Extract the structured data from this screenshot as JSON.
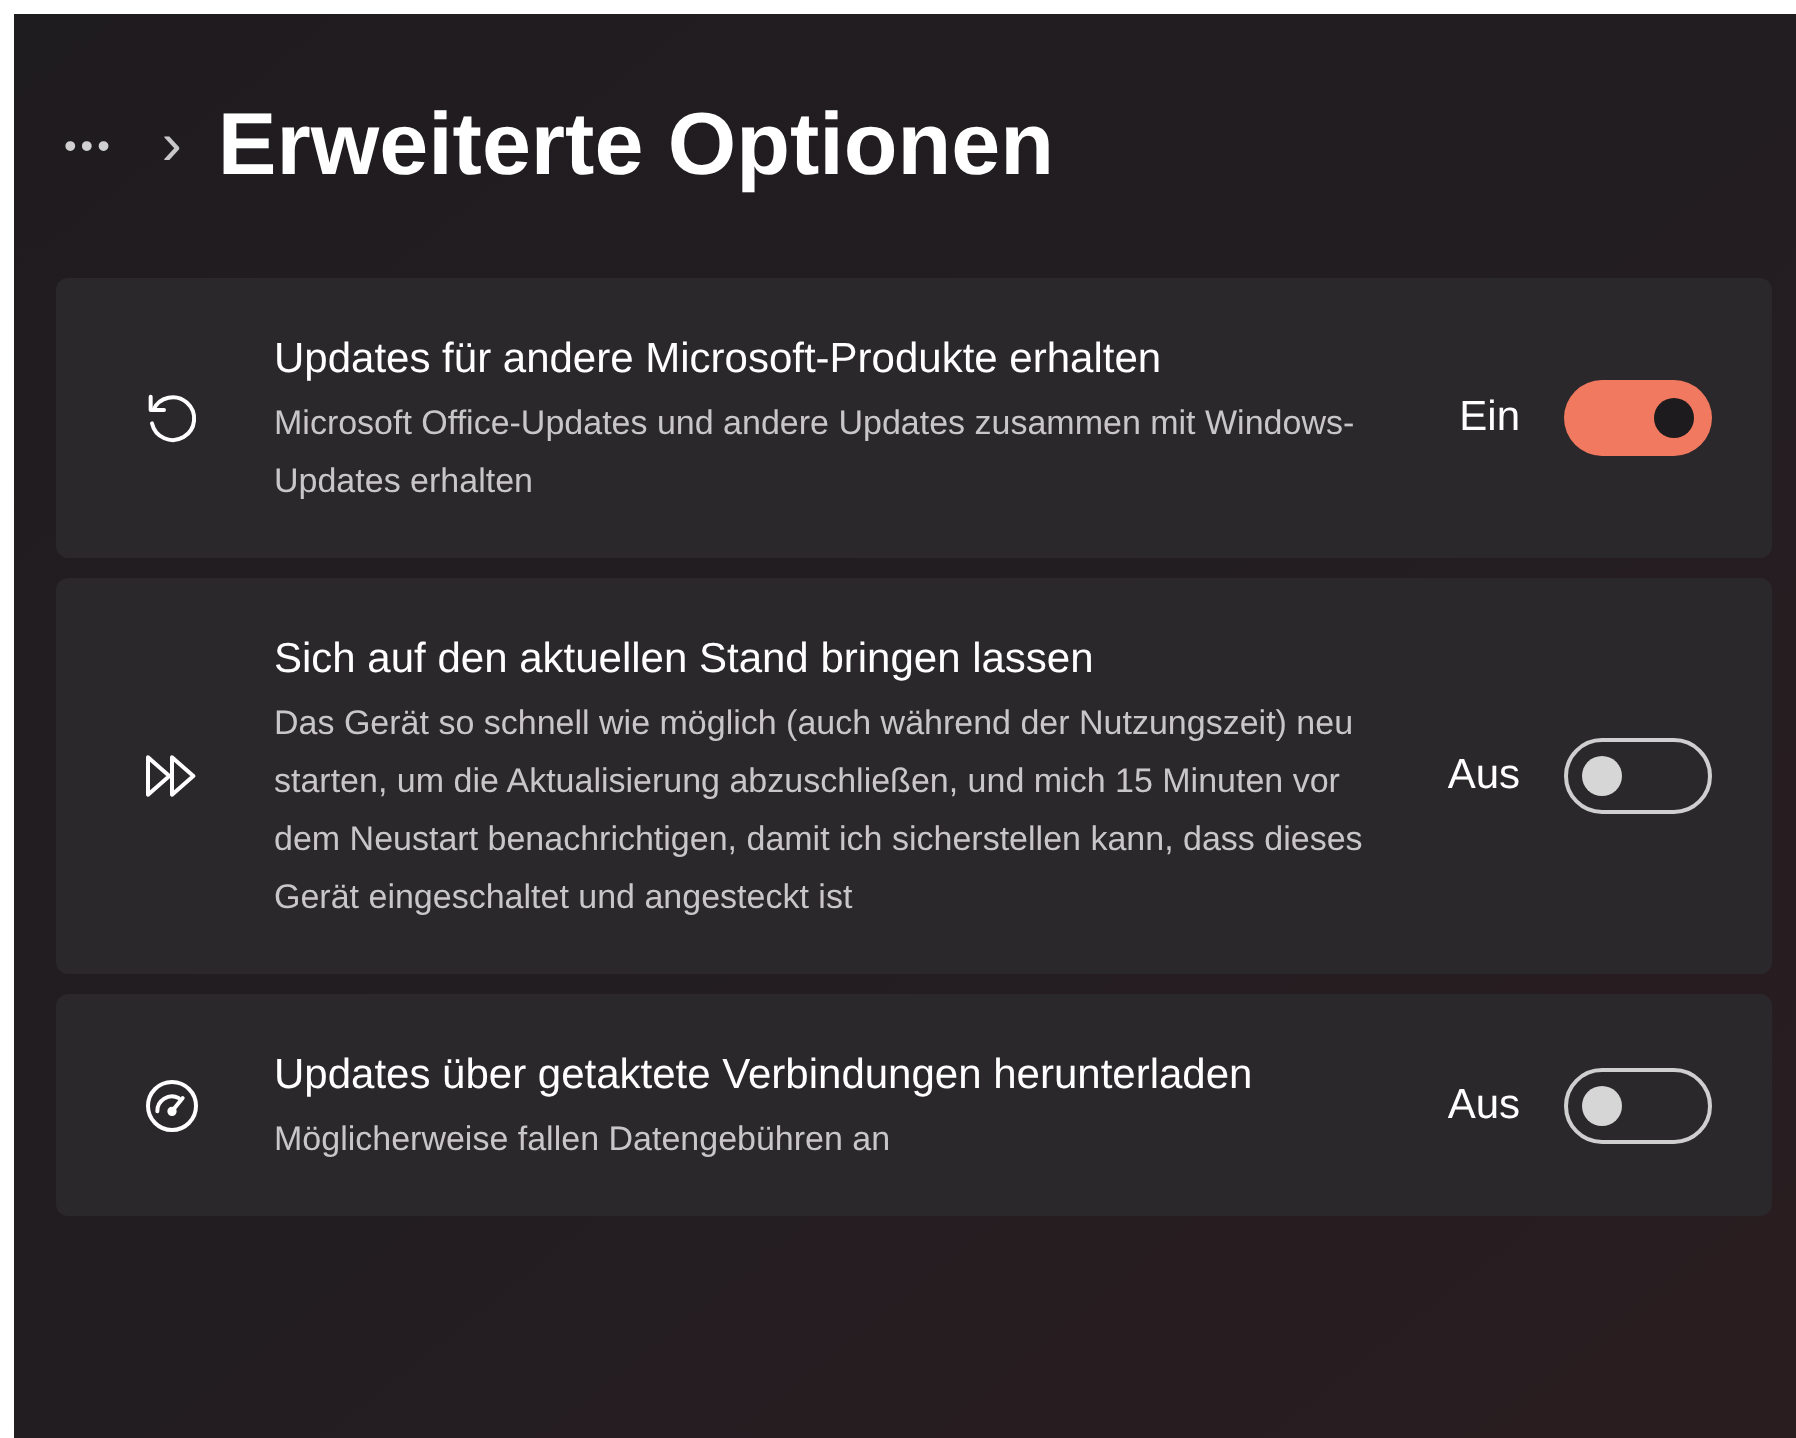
{
  "breadcrumb": {
    "more": "•••",
    "separator": "›",
    "title": "Erweiterte Optionen"
  },
  "settings": [
    {
      "kind": "refresh",
      "title": "Updates für andere Microsoft-Produkte erhalten",
      "description": "Microsoft Office-Updates und andere Updates zusammen mit Windows-Updates erhalten",
      "state_label": "Ein",
      "on": true
    },
    {
      "kind": "fast-forward",
      "title": "Sich auf den aktuellen Stand bringen lassen",
      "description": "Das Gerät so schnell wie möglich (auch während der Nutzungszeit) neu starten, um die Aktualisierung abzuschließen, und mich 15 Minuten vor dem Neustart benachrichtigen, damit ich sicherstellen kann, dass dieses Gerät eingeschaltet und angesteckt ist",
      "state_label": "Aus",
      "on": false
    },
    {
      "kind": "gauge",
      "title": "Updates über getaktete Verbindungen herunterladen",
      "description": "Möglicherweise fallen Datengebühren an",
      "state_label": "Aus",
      "on": false
    }
  ]
}
